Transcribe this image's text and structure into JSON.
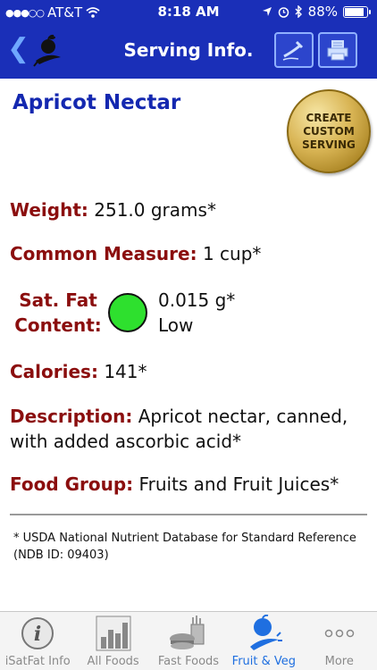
{
  "status": {
    "carrier": "AT&T",
    "time": "8:18 AM",
    "battery": "88%",
    "battery_level": 0.88
  },
  "nav": {
    "back_icon": "chevron-left-icon",
    "logo_icon": "fruit-logo-icon",
    "title": "Serving Info.",
    "right_buttons": [
      "edit-icon",
      "print-icon"
    ]
  },
  "food": {
    "name": "Apricot Nectar",
    "create_button": "CREATE CUSTOM SERVING",
    "weight": {
      "label": "Weight:",
      "value": "251.0 grams*"
    },
    "measure": {
      "label": "Common Measure:",
      "value": "1 cup*"
    },
    "satfat": {
      "label_line1": "Sat. Fat",
      "label_line2": "Content:",
      "amount": "0.015 g*",
      "level": "Low",
      "indicator_color": "#2ee02e"
    },
    "calories": {
      "label": "Calories:",
      "value": "141*"
    },
    "description": {
      "label": "Description:",
      "value": "Apricot nectar, canned, with added ascorbic acid*"
    },
    "group": {
      "label": "Food Group:",
      "value": "Fruits and Fruit Juices*"
    }
  },
  "footnote": "* USDA National Nutrient Database for Standard Reference (NDB ID: 09403)",
  "tabs": [
    {
      "label": "iSatFat Info",
      "icon": "info-icon",
      "active": false
    },
    {
      "label": "All Foods",
      "icon": "bar-chart-icon",
      "active": false
    },
    {
      "label": "Fast Foods",
      "icon": "fast-food-icon",
      "active": false
    },
    {
      "label": "Fruit & Veg",
      "icon": "fruit-veg-icon",
      "active": true
    },
    {
      "label": "More",
      "icon": "more-icon",
      "active": false
    }
  ],
  "colors": {
    "nav_bg": "#1a2fb8",
    "label_red": "#8b0e0e",
    "title_blue": "#1428b0",
    "tab_active": "#1f6fe0"
  }
}
